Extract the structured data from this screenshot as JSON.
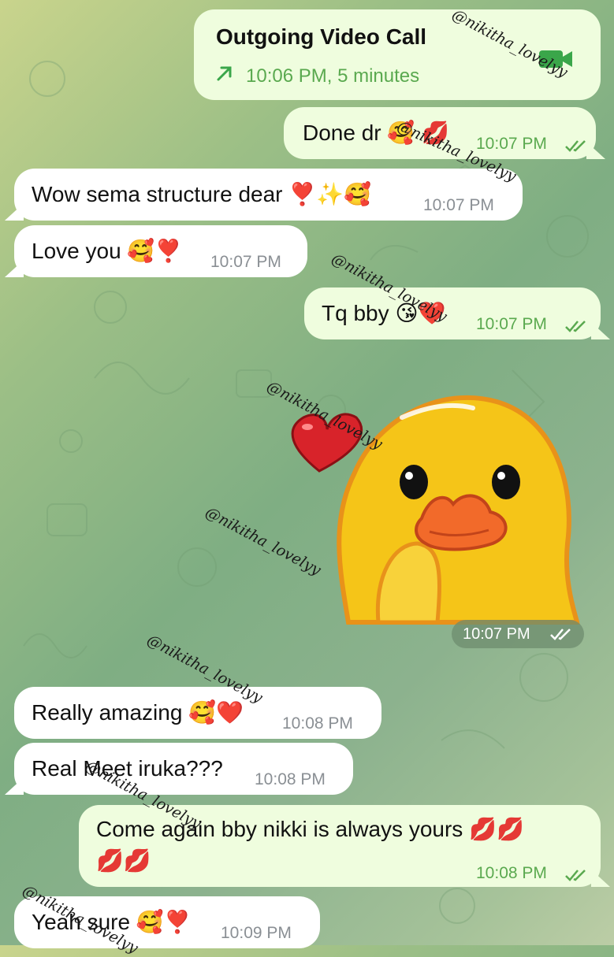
{
  "messages": [
    {
      "kind": "call",
      "title": "Outgoing Video Call",
      "info": "10:06 PM, 5 minutes",
      "icon": "arrow-up-right-icon",
      "camera_icon": "video-camera-icon"
    },
    {
      "kind": "out",
      "text": "Done dr",
      "emojis": "🥰 💋",
      "time": "10:07 PM",
      "status": "read"
    },
    {
      "kind": "in",
      "text": "Wow sema structure dear",
      "emojis": "❣️✨🥰",
      "time": "10:07 PM"
    },
    {
      "kind": "in",
      "text": "Love you",
      "emojis": "🥰❣️",
      "time": "10:07 PM"
    },
    {
      "kind": "out",
      "text": "Tq bby",
      "emojis": "😘❤️",
      "time": "10:07 PM",
      "status": "read"
    },
    {
      "kind": "sticker",
      "description": "yellow-duck-heart-sticker",
      "time": "10:07 PM",
      "status": "read"
    },
    {
      "kind": "in",
      "text": "Really amazing",
      "emojis": "🥰❤️",
      "time": "10:08 PM"
    },
    {
      "kind": "in",
      "text": "Real Meet iruka???",
      "time": "10:08 PM"
    },
    {
      "kind": "out",
      "text": "Come again bby nikki is always yours",
      "emojis": "💋💋",
      "emojis2": "💋💋",
      "time": "10:08 PM",
      "status": "read"
    },
    {
      "kind": "in",
      "text": "Yeah sure",
      "emojis": "🥰❣️",
      "time": "10:09 PM"
    }
  ],
  "watermark": "@nikitha_lovelyy",
  "colors": {
    "incoming": "#ffffff",
    "outgoing": "#effdde",
    "time_out": "#5aa94f",
    "time_in": "#8a8f94"
  }
}
